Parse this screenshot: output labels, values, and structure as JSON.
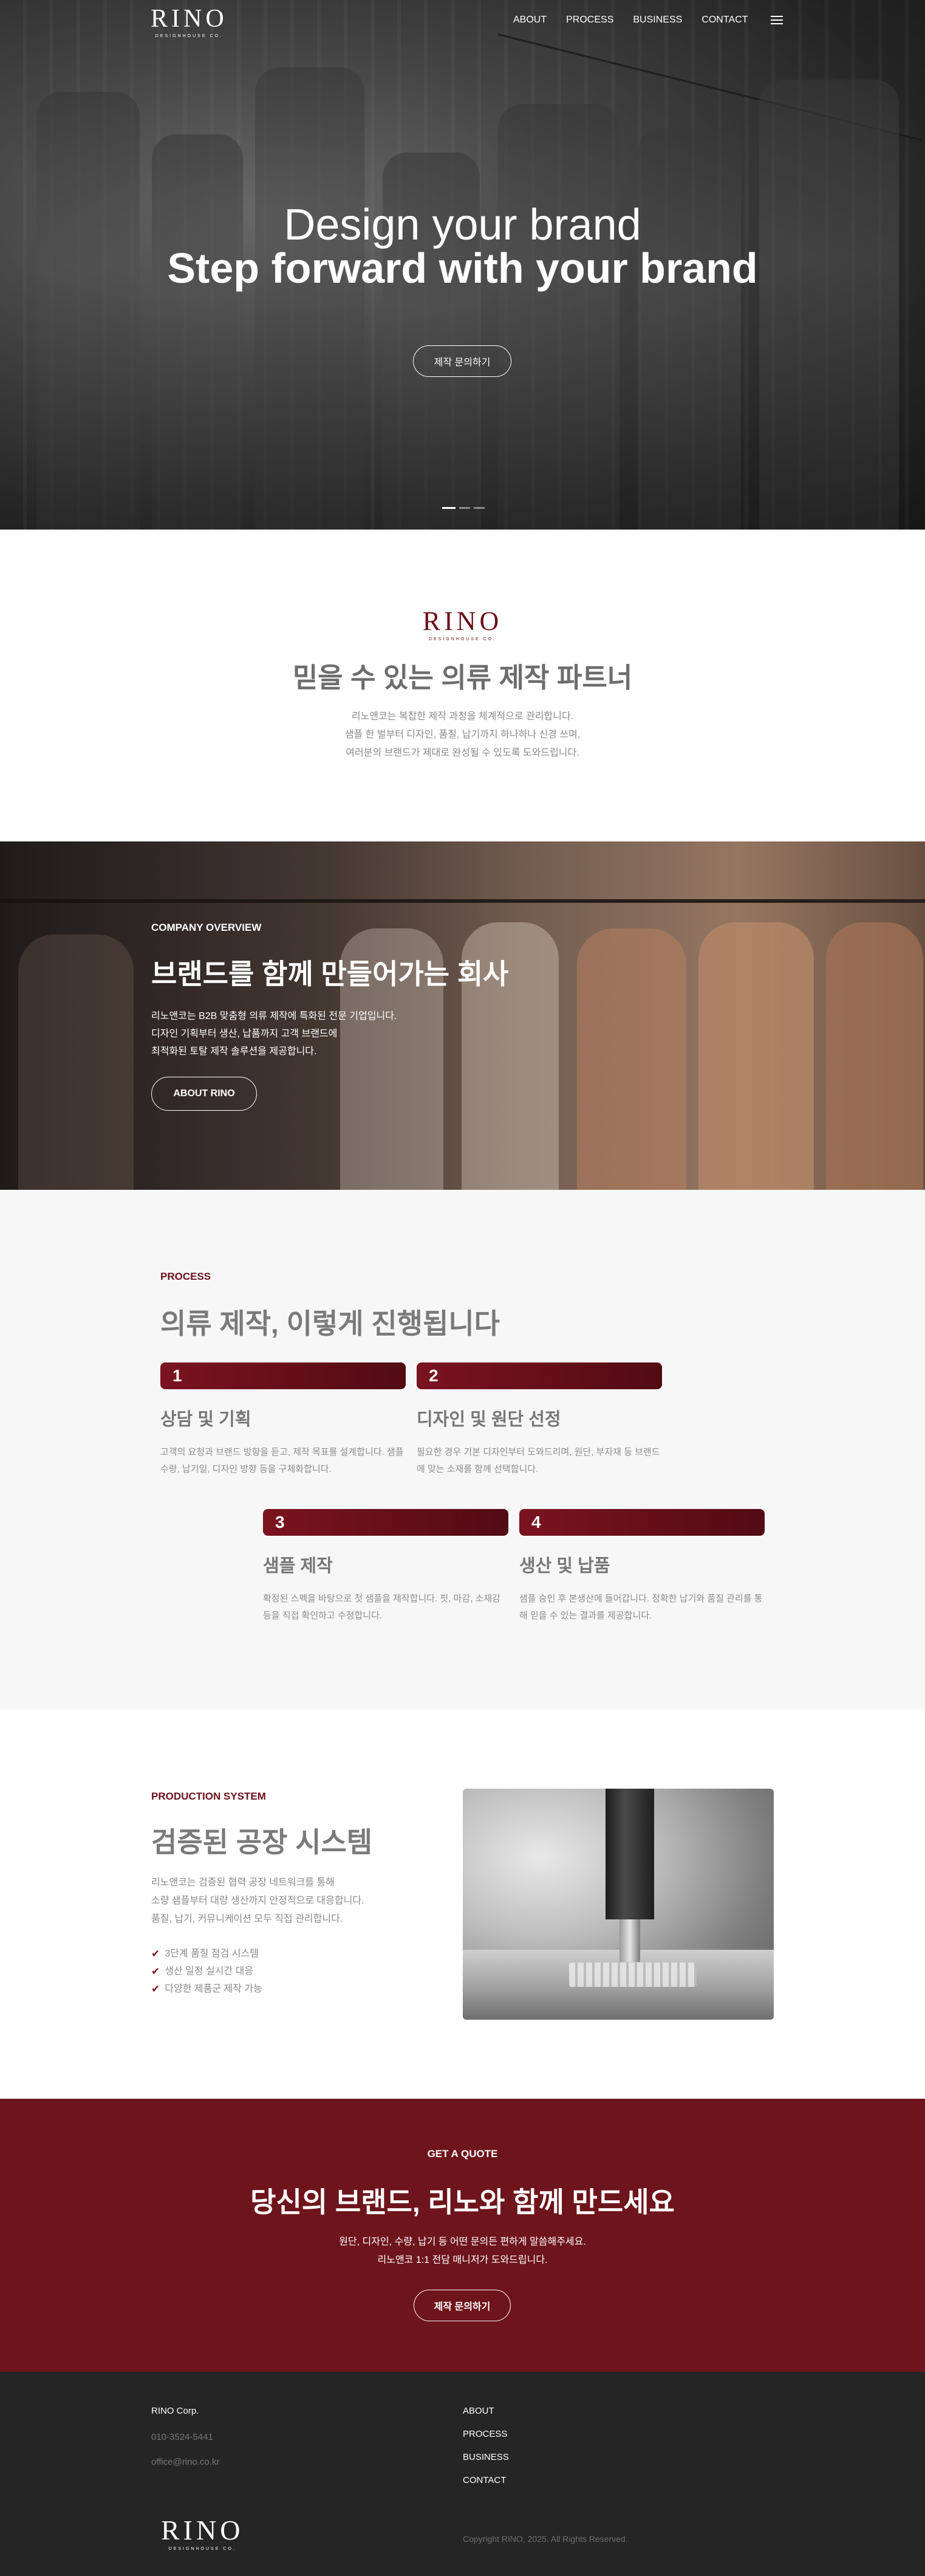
{
  "brand": {
    "logo_text": "RINO",
    "logo_sub": "DESIGNHOUSE CO."
  },
  "nav": {
    "items": [
      "ABOUT",
      "PROCESS",
      "BUSINESS",
      "CONTACT"
    ],
    "menu_icon": "hamburger-icon"
  },
  "hero": {
    "title": "Design your brand",
    "subtitle": "Step forward with your brand",
    "button": "제작 문의하기"
  },
  "intro": {
    "title": "믿을 수 있는 의류 제작 파트너",
    "lines": [
      "리노앤코는 복잡한 제작 과정을 체계적으로 관리합니다.",
      "샘플 한 벌부터 디자인, 품질, 납기까지 하나하나 신경 쓰며,",
      "여러분의 브랜드가 제대로 완성될 수 있도록 도와드립니다."
    ]
  },
  "overview": {
    "label": "COMPANY OVERVIEW",
    "title": "브랜드를 함께 만들어가는 회사",
    "lines": [
      "리노앤코는 B2B 맞춤형 의류 제작에 특화된 전문 기업입니다.",
      "디자인 기획부터 생산, 납품까지 고객 브랜드에",
      "최적화된 토탈 제작 솔루션을 제공합니다."
    ],
    "button": "ABOUT RINO"
  },
  "process": {
    "label": "PROCESS",
    "title": "의류 제작, 이렇게 진행됩니다",
    "steps": [
      {
        "number": "1",
        "title": "상담 및 기획",
        "desc": "고객의 요청과 브랜드 방향을 듣고, 제작 목표를 설계합니다. 샘플 수량, 납기일, 디자인 방향 등을 구체화합니다."
      },
      {
        "number": "2",
        "title": "디자인 및 원단 선정",
        "desc": "필요한 경우 기본 디자인부터 도와드리며, 원단, 부자재 등 브랜드에 맞는 소재를 함께 선택합니다."
      },
      {
        "number": "3",
        "title": "샘플 제작",
        "desc": "확정된 스펙을 바탕으로 첫 샘플을 제작합니다. 핏, 마감, 소재감 등을 직접 확인하고 수정합니다."
      },
      {
        "number": "4",
        "title": "생산 및 납품",
        "desc": "샘플 승인 후 본생산에 들어갑니다. 정확한 납기와 품질 관리를 통해 믿을 수 있는 결과를 제공합니다."
      }
    ]
  },
  "production": {
    "label": "PRODUCTION SYSTEM",
    "title": "검증된 공장 시스템",
    "lines": [
      "리노앤코는 검증된 협력 공장 네트워크를 통해",
      "소량 샘플부터 대량 생산까지 안정적으로 대응합니다.",
      "품질, 납기, 커뮤니케이션 모두 직접 관리합니다."
    ],
    "checks": [
      "3단계 품질 점검 시스템",
      "생산 일정 실시간 대응",
      "다양한 제품군 제작 가능"
    ]
  },
  "cta": {
    "label": "GET A QUOTE",
    "title": "당신의 브랜드, 리노와 함께 만드세요",
    "lines": [
      "원단, 디자인, 수량, 납기 등 어떤 문의든 편하게 말씀해주세요.",
      "리노앤코 1:1 전담 매니저가 도와드립니다."
    ],
    "button": "제작 문의하기"
  },
  "footer": {
    "company": "RINO Corp.",
    "phone": "010-3524-5441",
    "email": "office@rino.co.kr",
    "links": [
      "ABOUT",
      "PROCESS",
      "BUSINESS",
      "CONTACT"
    ],
    "copyright": "Copyright RINO, 2025. All Rights Reserved."
  },
  "colors": {
    "accent": "#6e141c",
    "footer_bg": "#252525",
    "section_bg": "#f7f7f7"
  }
}
